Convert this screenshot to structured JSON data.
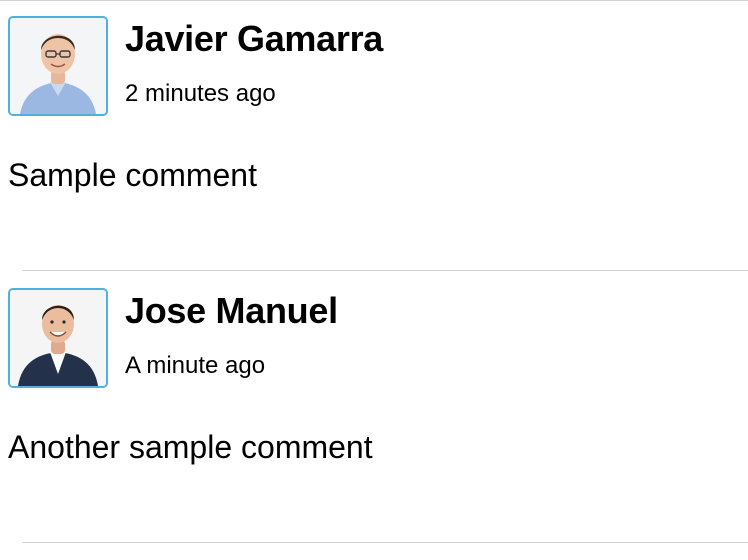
{
  "comments": [
    {
      "author": "Javier Gamarra",
      "time": "2 minutes ago",
      "text": "Sample comment",
      "avatar_icon": "person-avatar-icon"
    },
    {
      "author": "Jose Manuel",
      "time": "A minute ago",
      "text": "Another sample comment",
      "avatar_icon": "person-avatar-icon"
    }
  ],
  "colors": {
    "avatar_border": "#4db0de",
    "divider": "#d3d3d3"
  }
}
